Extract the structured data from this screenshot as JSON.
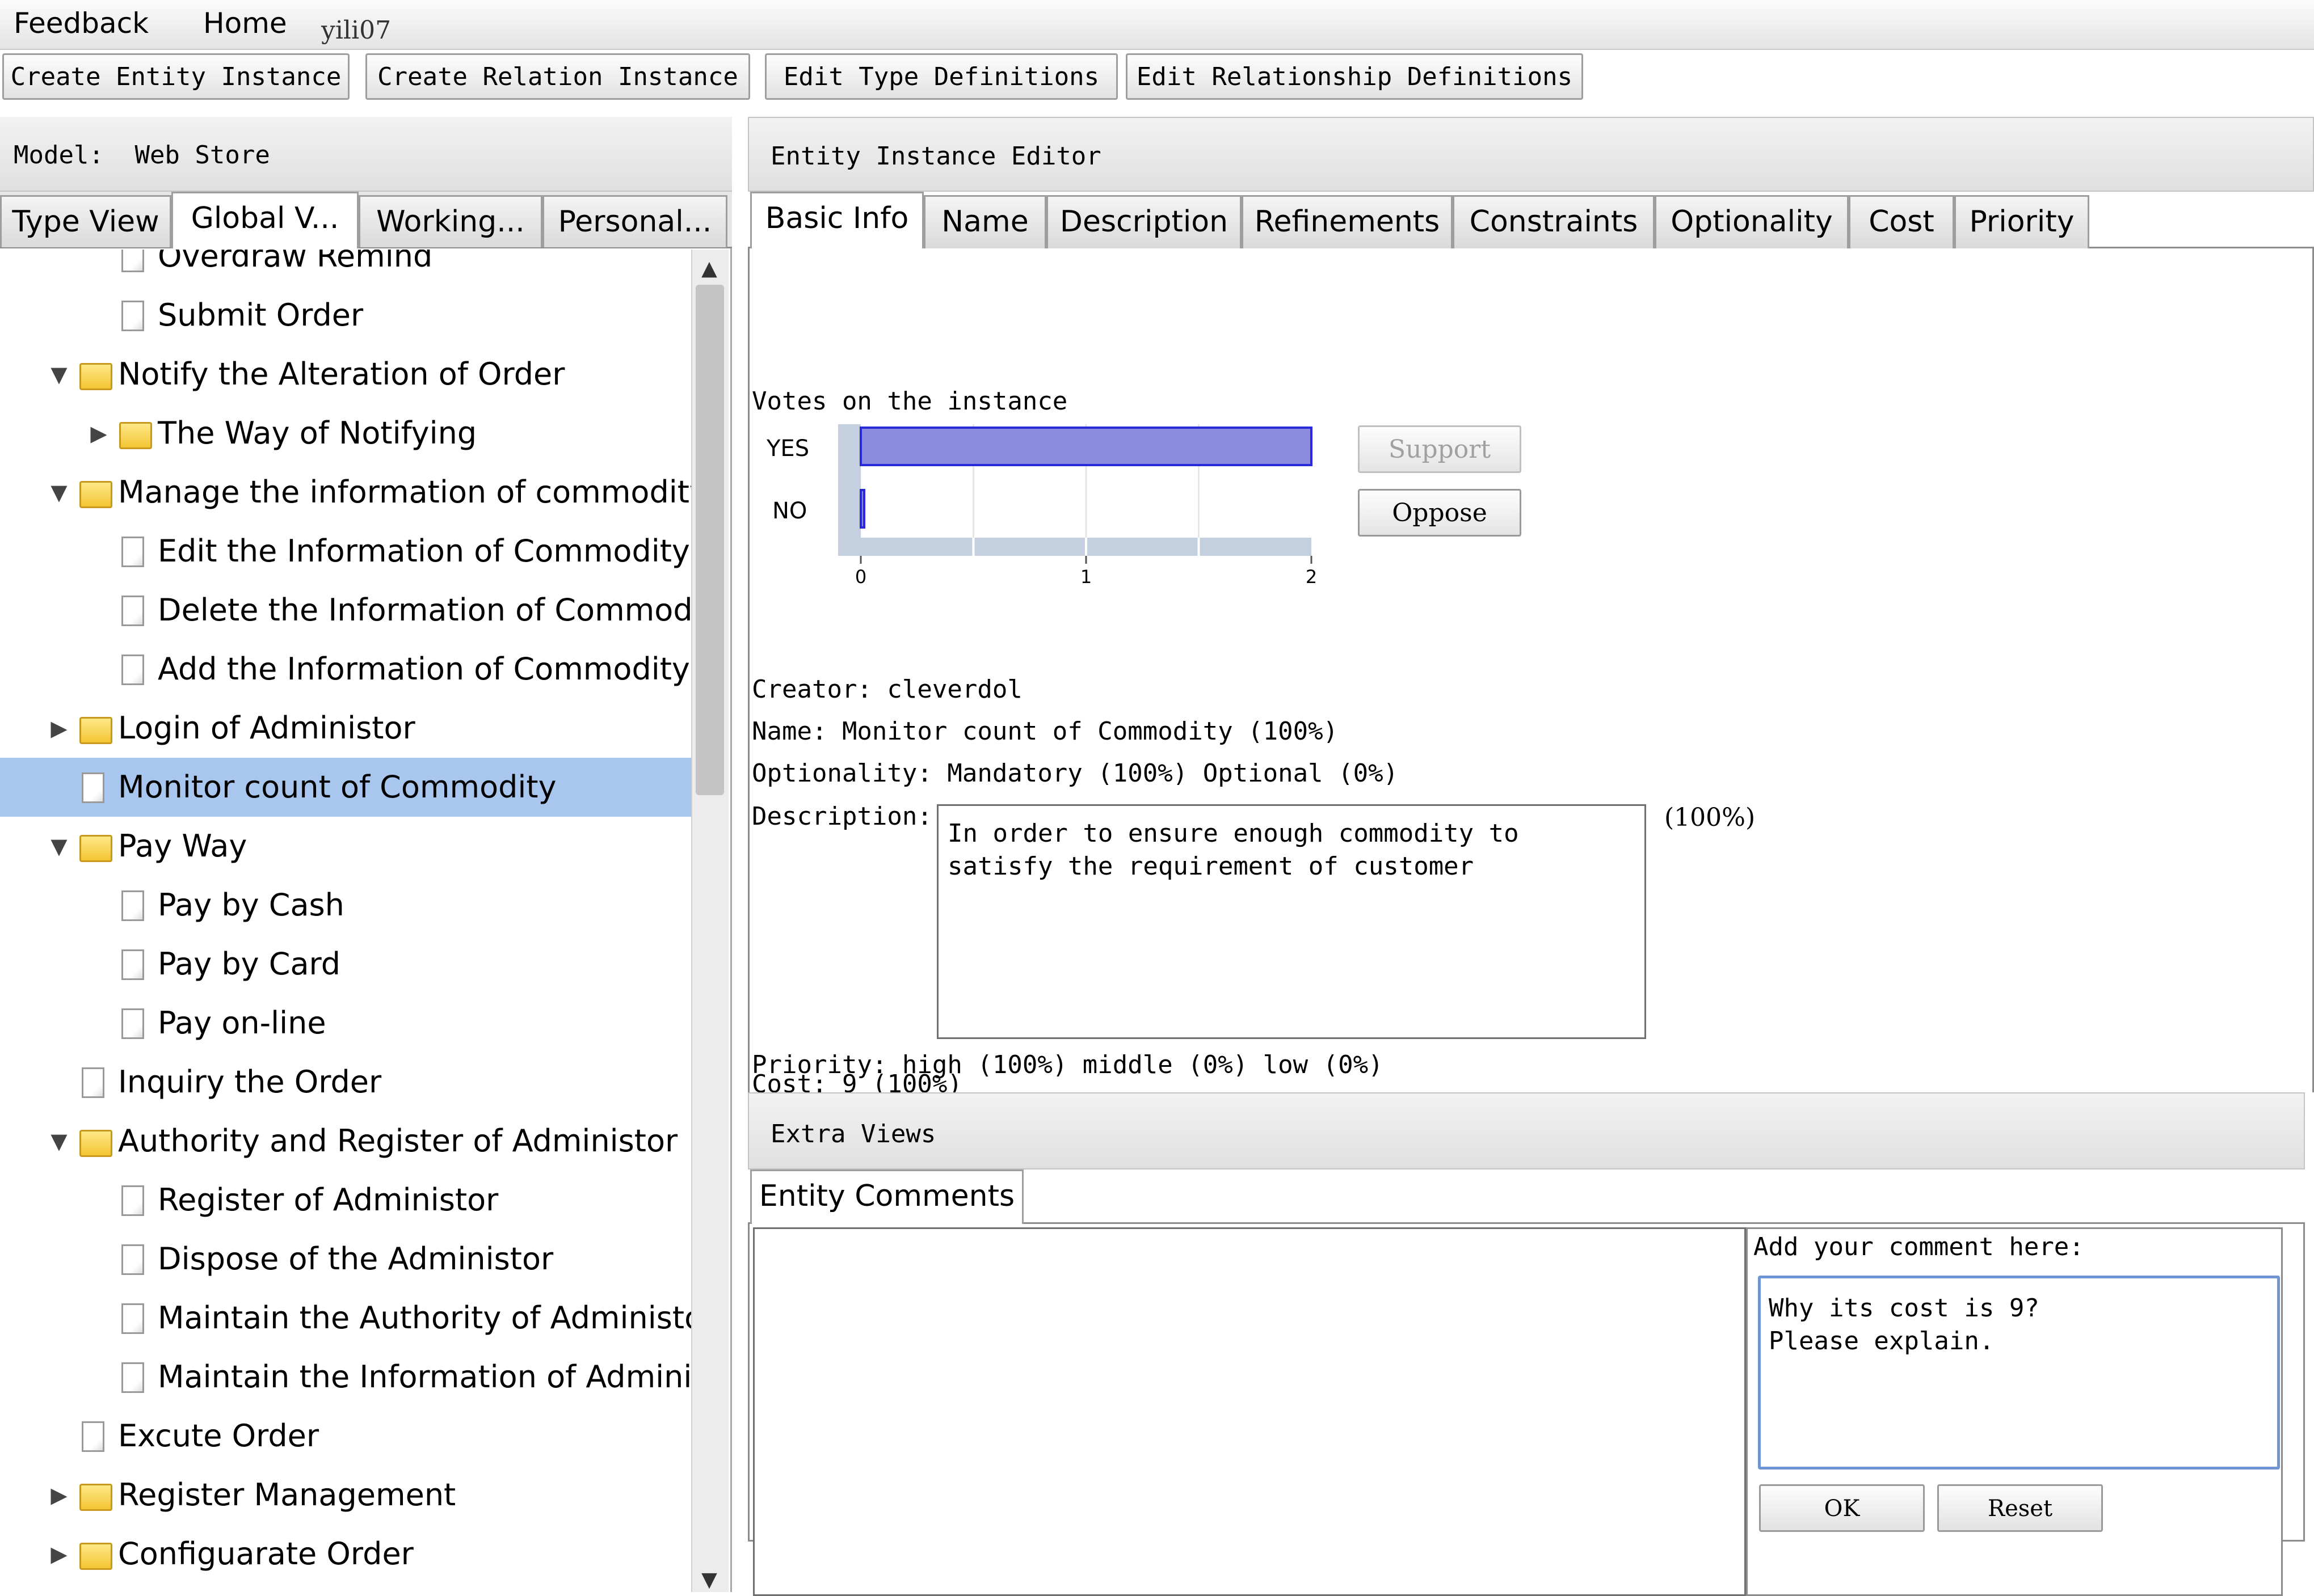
{
  "menu": {
    "feedback": "Feedback",
    "home": "Home",
    "user": "yili07"
  },
  "toolbar": {
    "create_entity": "Create Entity Instance",
    "create_relation": "Create Relation Instance",
    "edit_types": "Edit Type Definitions",
    "edit_relationships": "Edit Relationship Definitions"
  },
  "left": {
    "model_label": "Model:",
    "model_name": "Web Store",
    "tabs": [
      "Type View",
      "Global V...",
      "Working...",
      "Personal..."
    ],
    "tree": [
      {
        "label": "Overdraw Remind",
        "type": "doc",
        "arrow": ""
      },
      {
        "label": "Submit Order",
        "type": "doc",
        "arrow": ""
      },
      {
        "label": "Notify the Alteration of Order",
        "type": "folder",
        "arrow": "▼"
      },
      {
        "label": "The Way of Notifying",
        "type": "folder",
        "arrow": "▶"
      },
      {
        "label": "Manage the information of commodity",
        "type": "folder",
        "arrow": "▼"
      },
      {
        "label": "Edit the Information of Commodity",
        "type": "doc",
        "arrow": ""
      },
      {
        "label": "Delete the Information of Commodity",
        "type": "doc",
        "arrow": ""
      },
      {
        "label": "Add the Information of Commodity",
        "type": "doc",
        "arrow": ""
      },
      {
        "label": "Login of Administor",
        "type": "folder",
        "arrow": "▶"
      },
      {
        "label": "Monitor count of Commodity",
        "type": "doc",
        "arrow": ""
      },
      {
        "label": "Pay Way",
        "type": "folder",
        "arrow": "▼"
      },
      {
        "label": "Pay by Cash",
        "type": "doc",
        "arrow": ""
      },
      {
        "label": "Pay by Card",
        "type": "doc",
        "arrow": ""
      },
      {
        "label": "Pay on-line",
        "type": "doc",
        "arrow": ""
      },
      {
        "label": "Inquiry the Order",
        "type": "doc",
        "arrow": ""
      },
      {
        "label": "Authority and Register of Administor",
        "type": "folder",
        "arrow": "▼"
      },
      {
        "label": "Register of Administor",
        "type": "doc",
        "arrow": ""
      },
      {
        "label": "Dispose of the Administor",
        "type": "doc",
        "arrow": ""
      },
      {
        "label": "Maintain the Authority of Administor",
        "type": "doc",
        "arrow": ""
      },
      {
        "label": "Maintain the Information of Administo",
        "type": "doc",
        "arrow": ""
      },
      {
        "label": "Excute Order",
        "type": "doc",
        "arrow": ""
      },
      {
        "label": "Register Management",
        "type": "folder",
        "arrow": "▶"
      },
      {
        "label": "Configuarate Order",
        "type": "folder",
        "arrow": "▶"
      }
    ]
  },
  "editor": {
    "title": "Entity Instance Editor",
    "tabs": [
      "Basic Info",
      "Name",
      "Description",
      "Refinements",
      "Constraints",
      "Optionality",
      "Cost",
      "Priority"
    ],
    "votes_title": "Votes on the instance",
    "support_label": "Support",
    "oppose_label": "Oppose",
    "creator": "Creator: cleverdol",
    "name_line": "Name: Monitor count of Commodity (100%)",
    "optionality_line": "Optionality: Mandatory (100%) Optional (0%)",
    "description_label": "Description:",
    "description_text": "In order to ensure enough commodity to satisfy the requirement of customer",
    "description_pct": "(100%)",
    "priority_line": "Priority: high (100%) middle (0%) low (0%)",
    "cost_line": "Cost: 9 (100%)"
  },
  "chart_data": {
    "type": "bar",
    "orientation": "horizontal",
    "categories": [
      "YES",
      "NO"
    ],
    "values": [
      2,
      0
    ],
    "xlim": [
      0,
      2
    ],
    "xticks": [
      "0",
      "1",
      "2"
    ],
    "bar_color": "#8b8be0"
  },
  "extra": {
    "title": "Extra Views",
    "tab": "Entity Comments",
    "add_comment_label": "Add your comment here:",
    "comment_line1": "Why its cost is 9?",
    "comment_line2": "Please explain.",
    "ok_label": "OK",
    "reset_label": "Reset"
  },
  "colors": {
    "selection": "#a9c6ee",
    "bar": "#8b8be0",
    "focus": "#6f95d4"
  }
}
